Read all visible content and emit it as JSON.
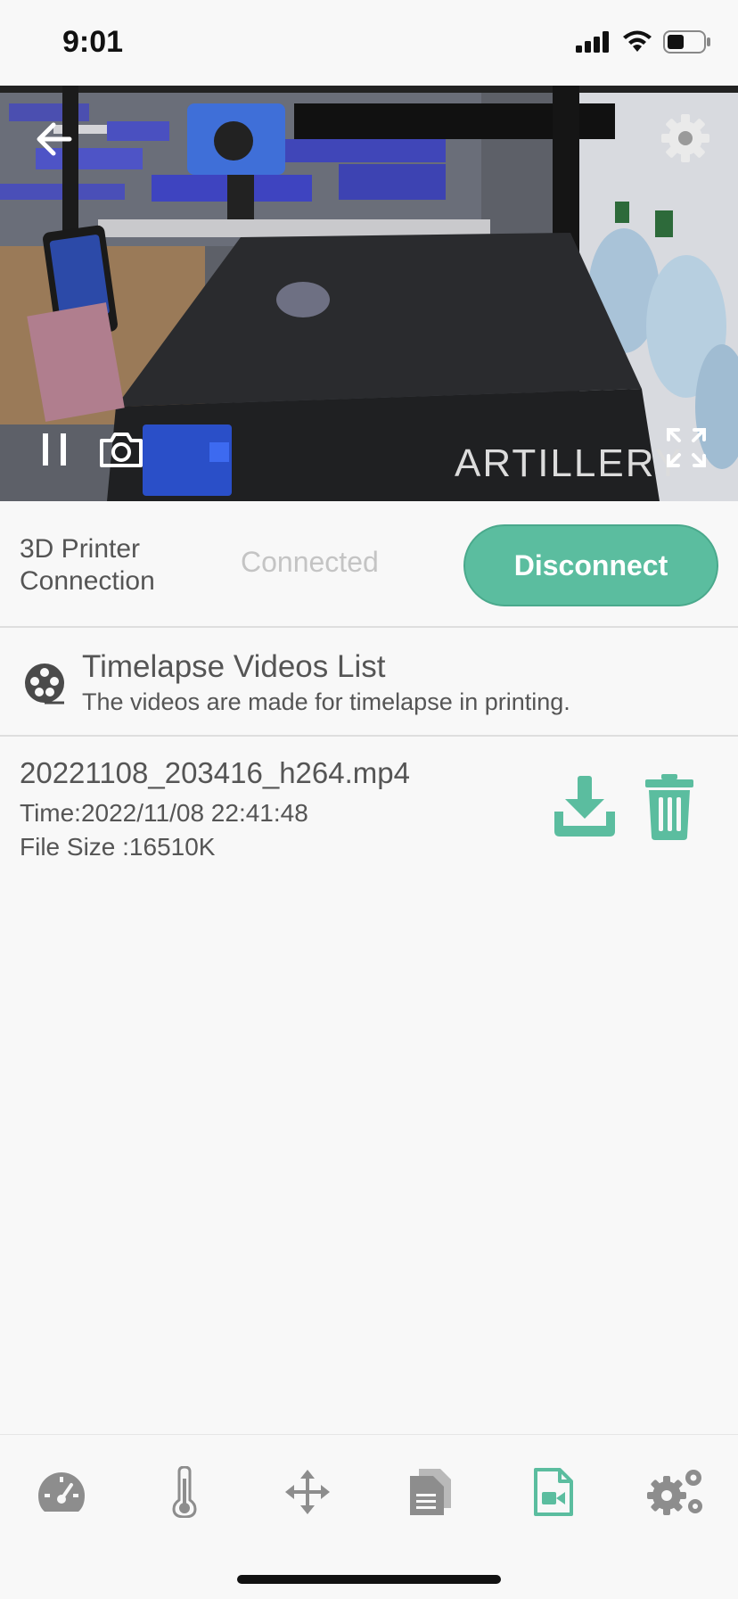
{
  "status_bar": {
    "time": "9:01",
    "icons": [
      "signal-icon",
      "wifi-icon",
      "battery-icon"
    ]
  },
  "camera": {
    "printer_brand_text": "ARTILLERY",
    "controls": [
      "back-arrow-icon",
      "settings-gear-icon",
      "pause-icon",
      "camera-snapshot-icon",
      "fullscreen-icon"
    ]
  },
  "connection": {
    "label_line1": "3D Printer",
    "label_line2": "Connection",
    "status": "Connected",
    "disconnect_label": "Disconnect"
  },
  "timelapse": {
    "title": "Timelapse Videos List",
    "subtitle": "The videos are made for timelapse in printing."
  },
  "files": [
    {
      "name": "20221108_203416_h264.mp4",
      "time": "Time:2022/11/08 22:41:48",
      "size": "File Size :16510K"
    }
  ],
  "bottom_nav": {
    "items": [
      "dashboard-gauge-icon",
      "thermometer-icon",
      "move-arrows-icon",
      "files-document-icon",
      "video-file-icon",
      "settings-gears-icon"
    ],
    "active_index": 4
  },
  "colors": {
    "accent": "#5bbd9f",
    "accent_dark": "#4aa98c",
    "text": "#555555",
    "muted": "#c4c4c4",
    "divider": "#dedede",
    "background": "#f8f8f8"
  }
}
